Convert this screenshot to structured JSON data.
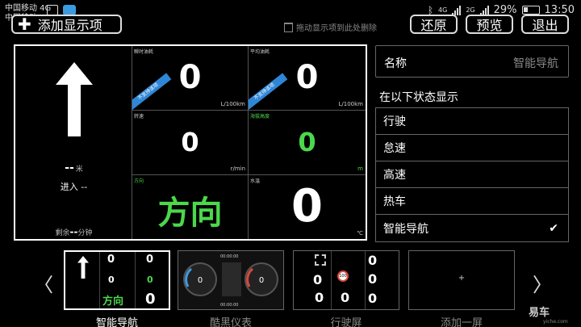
{
  "status_bar": {
    "carrier_1": "中国移动 4G",
    "carrier_2": "中国移动",
    "net_1": "4G",
    "net_2": "2G",
    "battery": "29%",
    "time": "13:50"
  },
  "toolbar": {
    "add_label": "添加显示项",
    "drag_hint": "拖动显示项到此处删除",
    "restore_label": "还原",
    "preview_label": "预览",
    "exit_label": "退出"
  },
  "preview": {
    "nav": {
      "distance": "--",
      "distance_unit": "米",
      "enter": "进入 --",
      "remain_prefix": "剩余",
      "remain_value": "--",
      "remain_unit": "分钟"
    },
    "cells": [
      {
        "label": "瞬时油耗",
        "value": "0",
        "unit": "L/100km",
        "ribbon": "不支持该项"
      },
      {
        "label": "平均油耗",
        "value": "0",
        "unit": "L/100km",
        "ribbon": "不支持该项"
      },
      {
        "label": "转速",
        "value": "0",
        "unit": "r/min"
      },
      {
        "label": "海拔高度",
        "value": "0",
        "unit": "m"
      },
      {
        "label": "方向",
        "value": "方向"
      },
      {
        "label": "水温",
        "value": "0",
        "unit": "℃"
      }
    ]
  },
  "settings": {
    "name_label": "名称",
    "name_value": "智能导航",
    "conditions_title": "在以下状态显示",
    "conditions": [
      {
        "label": "行驶",
        "checked": false
      },
      {
        "label": "怠速",
        "checked": false
      },
      {
        "label": "高速",
        "checked": false
      },
      {
        "label": "热车",
        "checked": false
      },
      {
        "label": "智能导航",
        "checked": true
      }
    ]
  },
  "screens": [
    {
      "label": "智能导航",
      "selected": true
    },
    {
      "label": "酷黑仪表",
      "selected": false
    },
    {
      "label": "行驶屏",
      "selected": false
    },
    {
      "label": "添加一屏",
      "selected": false
    }
  ],
  "thumb_text": {
    "zero": "0",
    "direction": "方向",
    "clock": "00:00:00",
    "add_plus": "+",
    "badge": "100"
  },
  "watermark": {
    "brand": "易车",
    "site": "yiche.com"
  },
  "colors": {
    "green": "#4bd84b",
    "ribbon_blue": "#2f86d6",
    "gauge_red": "#d9483b",
    "gauge_blue": "#3b9be0"
  }
}
